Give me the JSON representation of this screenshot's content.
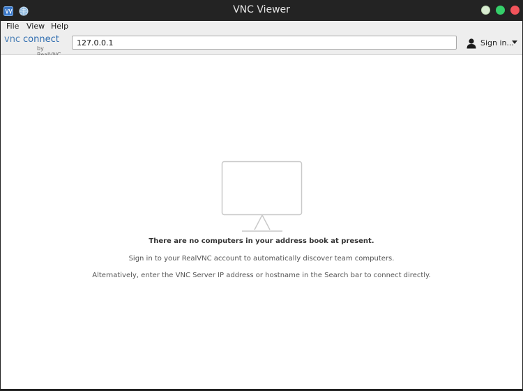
{
  "window": {
    "title": "VNC Viewer"
  },
  "menu": {
    "file": "File",
    "view": "View",
    "help": "Help"
  },
  "brand": {
    "vnc": "vnc",
    "connect": "connect",
    "by": "by RealVNC"
  },
  "search": {
    "value": "127.0.0.1"
  },
  "account": {
    "sign_in_label": "Sign in..."
  },
  "empty_state": {
    "title": "There are no computers in your address book at present.",
    "line1": "Sign in to your RealVNC account to automatically discover team computers.",
    "line2": "Alternatively, enter the VNC Server IP address or hostname in the Search bar to connect directly."
  },
  "colors": {
    "brand_blue": "#2f6db0",
    "close_button": "#f2545b",
    "maximize_button": "#35d06a",
    "minimize_button": "#d9ecd2"
  },
  "icons": {
    "app_left": "vnc-app-icon",
    "app_right": "globe-icon",
    "account": "user-icon",
    "empty_state": "monitor-icon"
  }
}
